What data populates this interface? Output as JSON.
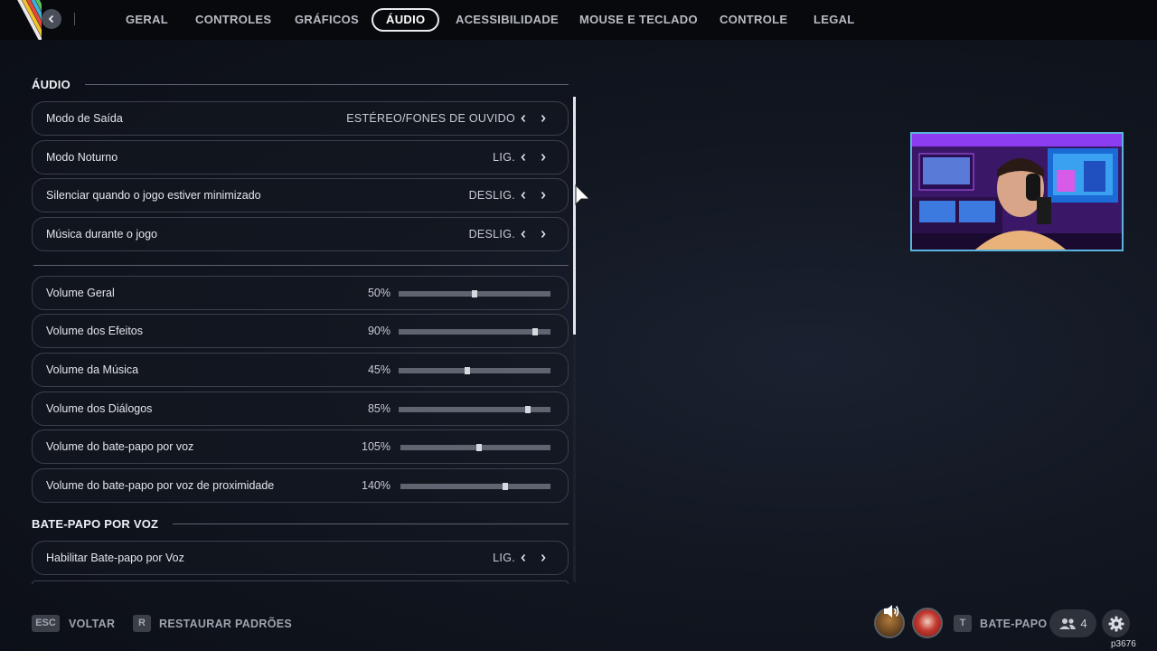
{
  "nav": {
    "tabs": [
      {
        "label": "GERAL"
      },
      {
        "label": "CONTROLES"
      },
      {
        "label": "GRÁFICOS"
      },
      {
        "label": "ÁUDIO",
        "active": true
      },
      {
        "label": "ACESSIBILIDADE"
      },
      {
        "label": "MOUSE E TECLADO"
      },
      {
        "label": "CONTROLE"
      },
      {
        "label": "LEGAL"
      }
    ]
  },
  "audio_section": {
    "title": "ÁUDIO",
    "toggles": [
      {
        "label": "Modo de Saída",
        "value": "ESTÉREO/FONES DE OUVIDO"
      },
      {
        "label": "Modo Noturno",
        "value": "LIG."
      },
      {
        "label": "Silenciar quando o jogo estiver minimizado",
        "value": "DESLIG."
      },
      {
        "label": "Música durante o jogo",
        "value": "DESLIG."
      }
    ],
    "sliders": [
      {
        "label": "Volume Geral",
        "value": "50%",
        "fill": 0.5
      },
      {
        "label": "Volume dos Efeitos",
        "value": "90%",
        "fill": 0.9
      },
      {
        "label": "Volume da Música",
        "value": "45%",
        "fill": 0.45
      },
      {
        "label": "Volume dos Diálogos",
        "value": "85%",
        "fill": 0.85
      },
      {
        "label": "Volume do bate-papo por voz",
        "value": "105%",
        "fill": 0.525
      },
      {
        "label": "Volume do bate-papo por voz de proximidade",
        "value": "140%",
        "fill": 0.7
      }
    ]
  },
  "voice_section": {
    "title": "BATE-PAPO POR VOZ",
    "toggles": [
      {
        "label": "Habilitar Bate-papo por Voz",
        "value": "LIG."
      }
    ]
  },
  "bottom": {
    "back_key": "ESC",
    "back_label": "VOLTAR",
    "reset_key": "R",
    "reset_label": "RESTAURAR PADRÕES",
    "chat_key": "T",
    "chat_label": "BATE-PAPO",
    "friends_count": "4",
    "watermark": "p3676"
  },
  "colors": {
    "accent_border": "#e8eaf0",
    "webcam_border": "#5ab4dd",
    "background": "#111620"
  },
  "icons": [
    "back-arrow-icon",
    "chevron-left-icon",
    "chevron-right-icon",
    "speaker-icon",
    "friends-icon",
    "gear-icon",
    "mouse-cursor-icon"
  ]
}
